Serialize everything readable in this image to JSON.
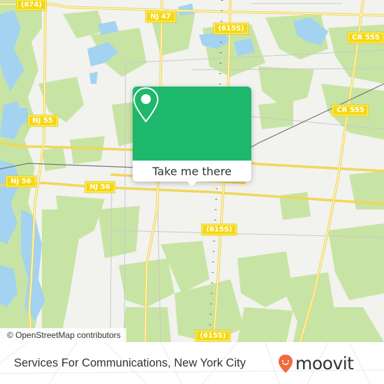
{
  "map": {
    "road_labels": [
      {
        "id": "674",
        "text": "(674)"
      },
      {
        "id": "nj47",
        "text": "NJ 47"
      },
      {
        "id": "615s-top",
        "text": "(615S)"
      },
      {
        "id": "cr555-top",
        "text": "CR 555"
      },
      {
        "id": "cr555-mid",
        "text": "CR 555"
      },
      {
        "id": "nj55",
        "text": "NJ 55"
      },
      {
        "id": "nj56-west",
        "text": "NJ 56"
      },
      {
        "id": "nj56-east",
        "text": "NJ 56"
      },
      {
        "id": "615s-mid",
        "text": "(615S)"
      },
      {
        "id": "615s-bottom",
        "text": "(615S)"
      }
    ],
    "attribution": "© OpenStreetMap contributors",
    "colors": {
      "land": "#f2f2ee",
      "forest": "#c8e4a4",
      "water": "#a3d3f0",
      "road_major": "#f5e06a",
      "road_minor": "#c8c8c8",
      "rail": "#777777"
    }
  },
  "popup": {
    "button_label": "Take me there",
    "accent": "#1db86b",
    "icon": "map-pin-icon"
  },
  "footer": {
    "place_name": "Services For Communications, New York City",
    "brand": "moovit",
    "brand_color": "#f26a3d"
  }
}
